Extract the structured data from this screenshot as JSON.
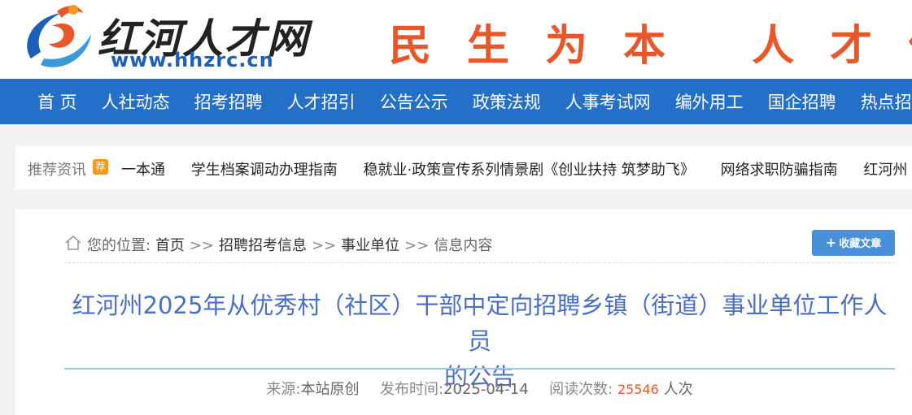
{
  "header": {
    "logo_title": "红河人才网",
    "logo_url": "www.hhzrc.cn",
    "slogan": "民生为本 人才优"
  },
  "nav": {
    "items": [
      "首 页",
      "人社动态",
      "招考招聘",
      "人才招引",
      "公告公示",
      "政策法规",
      "人事考试网",
      "编外用工",
      "国企招聘",
      "热点招"
    ]
  },
  "recommend": {
    "label": "推荐资讯",
    "badge": "荐",
    "items": [
      "一本通",
      "学生档案调动办理指南",
      "稳就业·政策宣传系列情景剧《创业扶持 筑梦助飞》",
      "网络求职防骗指南",
      "红河州"
    ]
  },
  "breadcrumb": {
    "prefix": "您的位置:",
    "items": [
      "首页",
      "招聘招考信息",
      "事业单位",
      "信息内容"
    ],
    "separator": ">>"
  },
  "favorite_button": {
    "label": "收藏文章"
  },
  "article": {
    "title_line1": "红河州2025年从优秀村（社区）干部中定向招聘乡镇（街道）事业单位工作人员",
    "title_line2": "的公告",
    "source_label": "来源:",
    "source": "本站原创",
    "publish_label": "发布时间:",
    "publish_date": "2025-04-14",
    "views_label": "阅读次数:",
    "views": "25546",
    "views_unit": "人次"
  },
  "colors": {
    "nav_bg": "#2470c8",
    "slogan": "#e8572a",
    "title": "#4a6fc4",
    "button": "#4a90d9",
    "badge": "#f39a1e"
  }
}
